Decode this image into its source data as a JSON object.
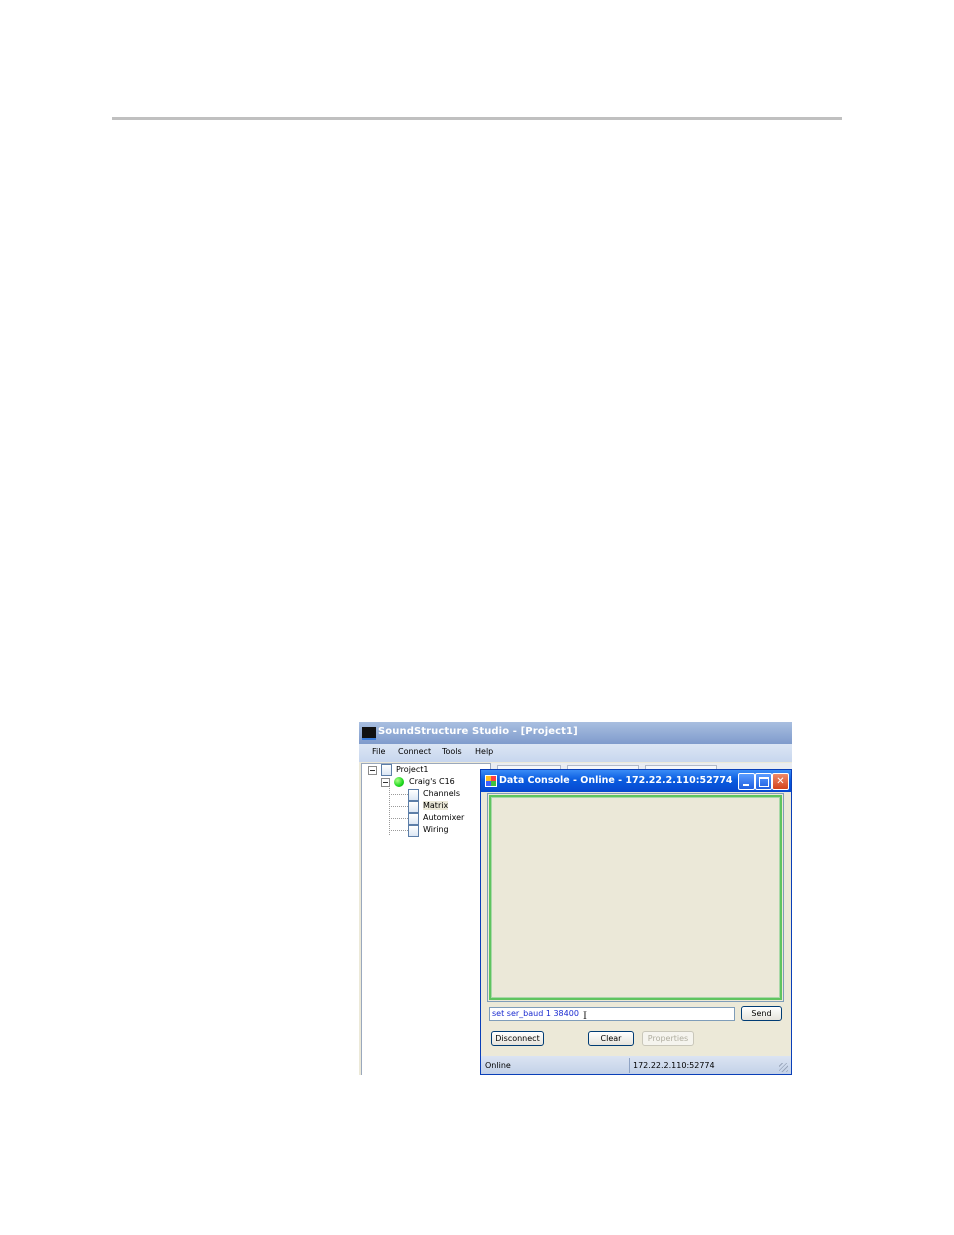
{
  "app": {
    "title": "SoundStructure Studio - [Project1]",
    "menu": [
      "File",
      "Connect",
      "Tools",
      "Help"
    ]
  },
  "tree": {
    "root": "Project1",
    "device": "Craig's C16",
    "children": [
      "Channels",
      "Matrix",
      "Automixer",
      "Wiring"
    ]
  },
  "dialog": {
    "title": "Data Console - Online - 172.22.2.110:52774",
    "command_value": "set ser_baud 1 38400",
    "send_label": "Send",
    "disconnect_label": "Disconnect",
    "clear_label": "Clear",
    "properties_label": "Properties",
    "status": "Online",
    "address": "172.22.2.110:52774"
  },
  "colors": {
    "dialog_title": "#0a5ce0",
    "output_border": "#5fc45f",
    "status_online": "#1ed81e"
  }
}
